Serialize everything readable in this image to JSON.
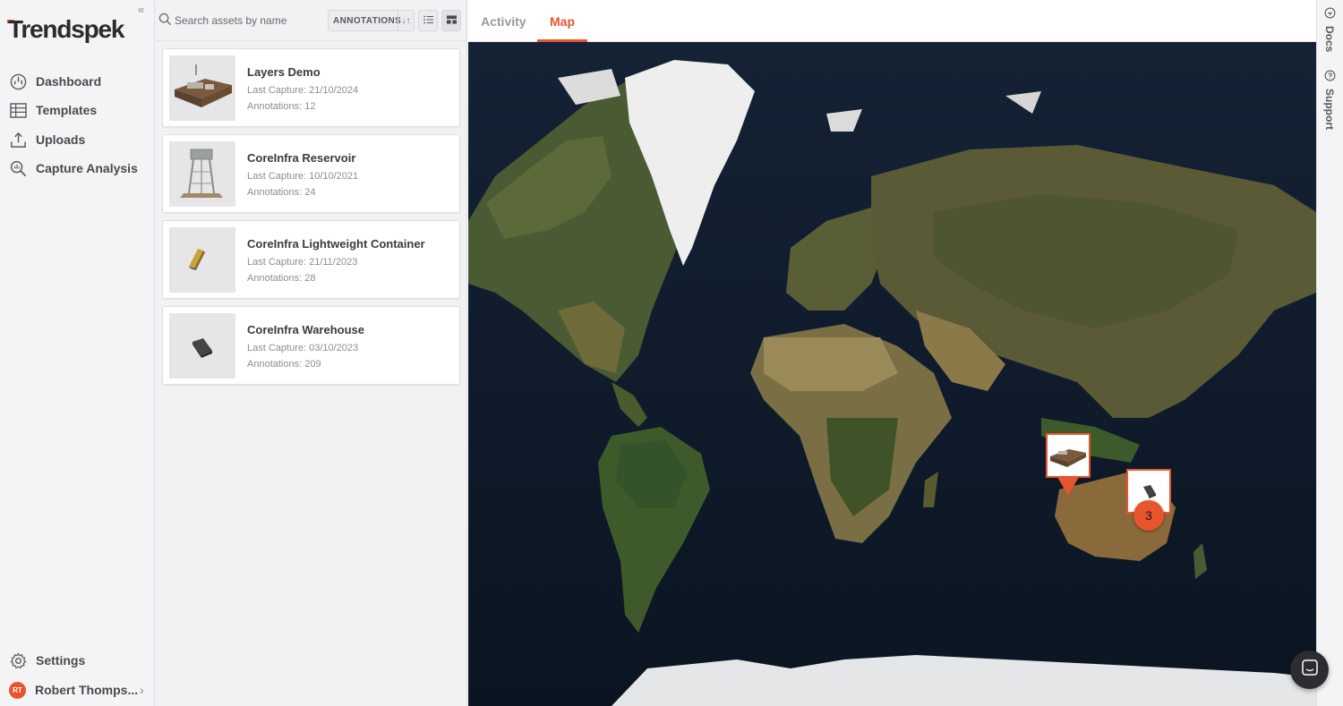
{
  "brand": {
    "name": "Trendspek",
    "accent": "#e8542c"
  },
  "nav": {
    "collapse_icon": "double-chevron-left-icon",
    "items": [
      {
        "label": "Dashboard",
        "icon": "dashboard-icon"
      },
      {
        "label": "Templates",
        "icon": "table-icon"
      },
      {
        "label": "Uploads",
        "icon": "upload-icon"
      },
      {
        "label": "Capture Analysis",
        "icon": "analysis-icon"
      }
    ],
    "settings_label": "Settings",
    "user": {
      "initials": "RT",
      "name": "Robert Thomps..."
    }
  },
  "assets": {
    "search_placeholder": "Search assets by name",
    "sort_label": "ANNOTATIONS",
    "list": [
      {
        "name": "Layers Demo",
        "last_capture": "Last Capture: 21/10/2024",
        "annotations": "Annotations: 12"
      },
      {
        "name": "CoreInfra Reservoir",
        "last_capture": "Last Capture: 10/10/2021",
        "annotations": "Annotations: 24"
      },
      {
        "name": "CoreInfra Lightweight Container",
        "last_capture": "Last Capture: 21/11/2023",
        "annotations": "Annotations: 28"
      },
      {
        "name": "CoreInfra Warehouse",
        "last_capture": "Last Capture: 03/10/2023",
        "annotations": "Annotations: 209"
      }
    ]
  },
  "tabs": [
    {
      "label": "Activity",
      "active": false
    },
    {
      "label": "Map",
      "active": true
    }
  ],
  "map": {
    "cluster_count": "3"
  },
  "rail": {
    "docs_label": "Docs",
    "support_label": "Support"
  }
}
